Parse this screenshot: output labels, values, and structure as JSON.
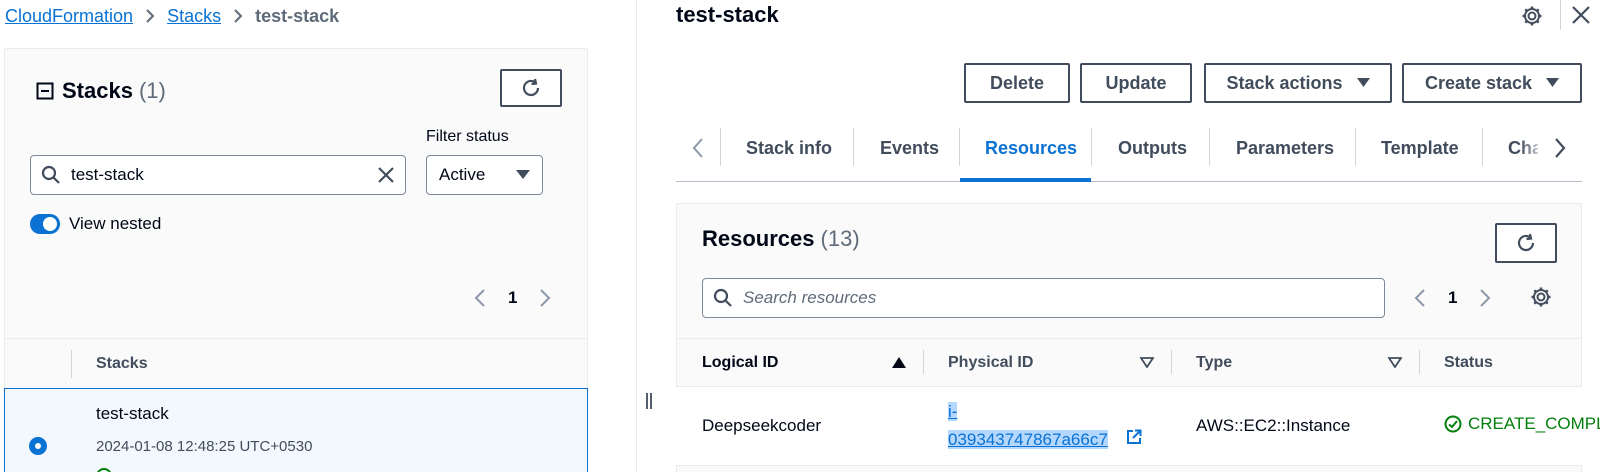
{
  "breadcrumb": {
    "items": [
      "CloudFormation",
      "Stacks",
      "test-stack"
    ]
  },
  "left": {
    "title": "Stacks",
    "count": "(1)",
    "search_value": "test-stack",
    "filter_label": "Filter status",
    "filter_value": "Active",
    "view_nested_label": "View nested",
    "page": "1",
    "column_header": "Stacks",
    "row": {
      "name": "test-stack",
      "created": "2024-01-08 12:48:25 UTC+0530"
    }
  },
  "main": {
    "title": "test-stack",
    "buttons": {
      "delete": "Delete",
      "update": "Update",
      "stack_actions": "Stack actions",
      "create_stack": "Create stack"
    },
    "tabs": [
      "Stack info",
      "Events",
      "Resources",
      "Outputs",
      "Parameters",
      "Template",
      "Change sets"
    ],
    "active_tab": "Resources"
  },
  "resources": {
    "title": "Resources",
    "count": "(13)",
    "search_placeholder": "Search resources",
    "page": "1",
    "columns": [
      "Logical ID",
      "Physical ID",
      "Type",
      "Status"
    ],
    "rows": [
      {
        "logical_id": "Deepseekcoder",
        "physical_id_line1": "i-",
        "physical_id_line2": "039343747867a66c7",
        "type": "AWS::EC2::Instance",
        "status": "CREATE_COMPLETE"
      }
    ]
  },
  "colors": {
    "link": "#0972d3",
    "success": "#037f0c",
    "border": "#414d5c"
  }
}
